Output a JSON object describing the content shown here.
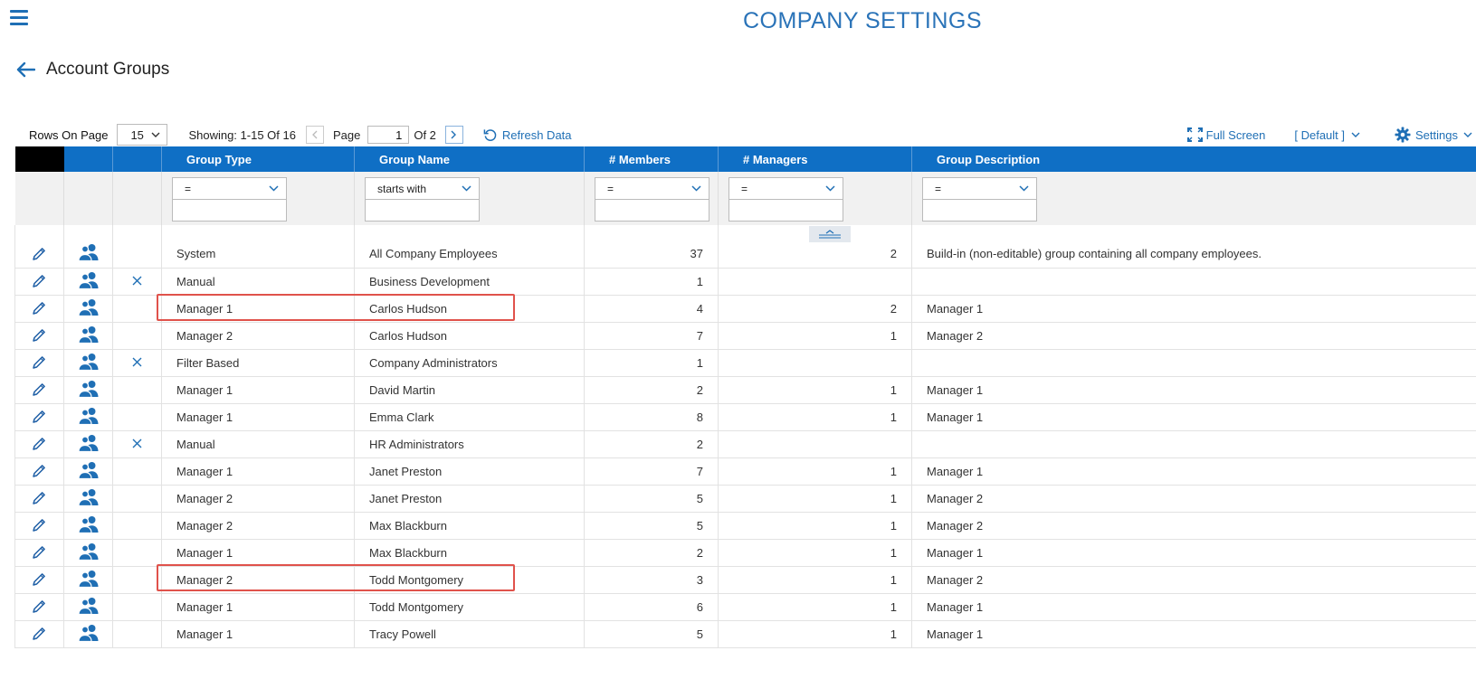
{
  "header": {
    "title": "COMPANY SETTINGS",
    "page_title": "Account Groups"
  },
  "toolbar": {
    "rows_label": "Rows On Page",
    "rows_value": "15",
    "showing_text": "Showing: 1-15 Of 16",
    "page_label": "Page",
    "page_value": "1",
    "of_text": "Of 2",
    "refresh_label": "Refresh Data",
    "fullscreen_label": "Full Screen",
    "view_label": "[ Default ]",
    "settings_label": "Settings"
  },
  "columns": [
    "Group Type",
    "Group Name",
    "# Members",
    "# Managers",
    "Group Description"
  ],
  "filters": {
    "group_type": "=",
    "group_name": "starts with",
    "members": "=",
    "managers": "=",
    "description": "="
  },
  "rows": [
    {
      "type": "System",
      "name": "All Company Employees",
      "members": "37",
      "managers": "2",
      "description": "Build-in (non-editable) group containing all company employees.",
      "deletable": false
    },
    {
      "type": "Manual",
      "name": "Business Development",
      "members": "1",
      "managers": "",
      "description": "",
      "deletable": true
    },
    {
      "type": "Manager 1",
      "name": "Carlos Hudson",
      "members": "4",
      "managers": "2",
      "description": "Manager 1",
      "deletable": false
    },
    {
      "type": "Manager 2",
      "name": "Carlos Hudson",
      "members": "7",
      "managers": "1",
      "description": "Manager 2",
      "deletable": false
    },
    {
      "type": "Filter Based",
      "name": "Company Administrators",
      "members": "1",
      "managers": "",
      "description": "",
      "deletable": true
    },
    {
      "type": "Manager 1",
      "name": "David Martin",
      "members": "2",
      "managers": "1",
      "description": "Manager 1",
      "deletable": false
    },
    {
      "type": "Manager 1",
      "name": "Emma Clark",
      "members": "8",
      "managers": "1",
      "description": "Manager 1",
      "deletable": false
    },
    {
      "type": "Manual",
      "name": "HR Administrators",
      "members": "2",
      "managers": "",
      "description": "",
      "deletable": true
    },
    {
      "type": "Manager 1",
      "name": "Janet Preston",
      "members": "7",
      "managers": "1",
      "description": "Manager 1",
      "deletable": false
    },
    {
      "type": "Manager 2",
      "name": "Janet Preston",
      "members": "5",
      "managers": "1",
      "description": "Manager 2",
      "deletable": false
    },
    {
      "type": "Manager 2",
      "name": "Max Blackburn",
      "members": "5",
      "managers": "1",
      "description": "Manager 2",
      "deletable": false
    },
    {
      "type": "Manager 1",
      "name": "Max Blackburn",
      "members": "2",
      "managers": "1",
      "description": "Manager 1",
      "deletable": false
    },
    {
      "type": "Manager 2",
      "name": "Todd Montgomery",
      "members": "3",
      "managers": "1",
      "description": "Manager 2",
      "deletable": false
    },
    {
      "type": "Manager 1",
      "name": "Todd Montgomery",
      "members": "6",
      "managers": "1",
      "description": "Manager 1",
      "deletable": false
    },
    {
      "type": "Manager 1",
      "name": "Tracy Powell",
      "members": "5",
      "managers": "1",
      "description": "Manager 1",
      "deletable": false
    }
  ],
  "colors": {
    "accent": "#1f6fb5",
    "header_bg": "#0f6fc5",
    "highlight": "#e0524b"
  },
  "icons": {
    "menu": "hamburger-menu-icon",
    "back": "back-arrow-icon",
    "edit": "pencil-icon",
    "members": "users-icon",
    "delete": "x-icon",
    "refresh": "refresh-icon",
    "fullscreen": "fullscreen-icon",
    "settings": "gear-icon"
  }
}
